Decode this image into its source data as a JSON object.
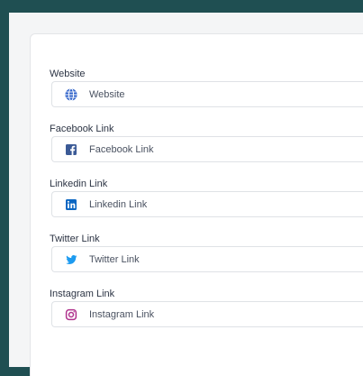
{
  "colors": {
    "background": "#1f4f52",
    "website": "#2f62c9",
    "facebook": "#3b5a96",
    "linkedin": "#0a66c2",
    "twitter": "#1d9bf0",
    "instagram": "#b0328d"
  },
  "form": {
    "fields": [
      {
        "label": "Website",
        "placeholder": "Website",
        "icon": "globe-icon"
      },
      {
        "label": "Facebook Link",
        "placeholder": "Facebook Link",
        "icon": "facebook-icon"
      },
      {
        "label": "Linkedin Link",
        "placeholder": "Linkedin Link",
        "icon": "linkedin-icon"
      },
      {
        "label": "Twitter Link",
        "placeholder": "Twitter Link",
        "icon": "twitter-icon"
      },
      {
        "label": "Instagram Link",
        "placeholder": "Instagram Link",
        "icon": "instagram-icon"
      }
    ]
  }
}
